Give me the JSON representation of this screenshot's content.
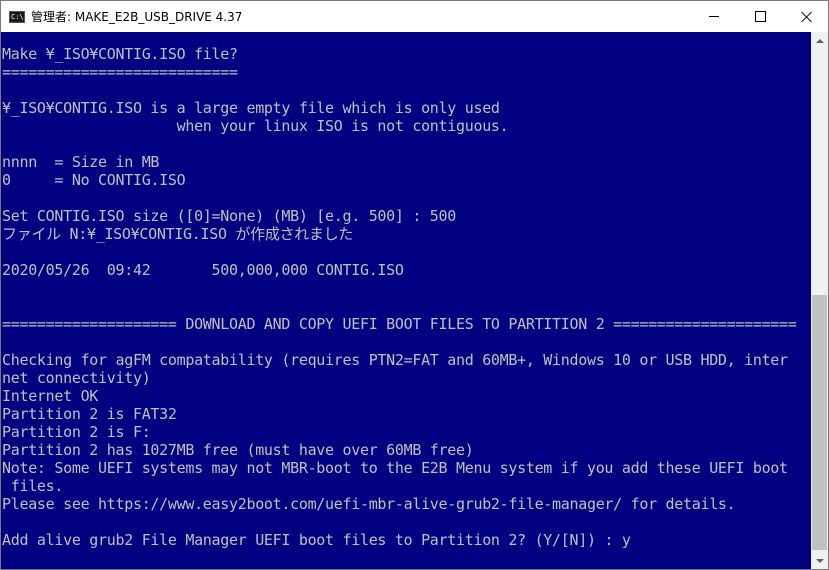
{
  "window": {
    "title": "管理者:  MAKE_E2B_USB_DRIVE 4.37",
    "icon": "console-icon",
    "icon_glyph": "C:\\",
    "minimize_glyph": "",
    "maximize_glyph": "",
    "close_glyph": ""
  },
  "colors": {
    "console_background": "#000080",
    "console_text": "#c0c0c0",
    "titlebar_background": "#ffffff"
  },
  "console": {
    "lines": [
      "Make ¥_ISO¥CONTIG.ISO file?",
      "===========================",
      "",
      "¥_ISO¥CONTIG.ISO is a large empty file which is only used",
      "                    when your linux ISO is not contiguous.",
      "",
      "nnnn  = Size in MB",
      "0     = No CONTIG.ISO",
      "",
      "Set CONTIG.ISO size ([0]=None) (MB) [e.g. 500] : 500",
      "ファイル N:¥_ISO¥CONTIG.ISO が作成されました",
      "",
      "2020/05/26  09:42       500,000,000 CONTIG.ISO",
      "",
      "",
      "==================== DOWNLOAD AND COPY UEFI BOOT FILES TO PARTITION 2 =====================",
      "",
      "Checking for agFM compatability (requires PTN2=FAT and 60MB+, Windows 10 or USB HDD, inter",
      "net connectivity)",
      "Internet OK",
      "Partition 2 is FAT32",
      "Partition 2 is F:",
      "Partition 2 has 1027MB free (must have over 60MB free)",
      "Note: Some UEFI systems may not MBR-boot to the E2B Menu system if you add these UEFI boot",
      " files.",
      "Please see https://www.easy2boot.com/uefi-mbr-alive-grub2-file-manager/ for details.",
      "",
      "Add alive grub2 File Manager UEFI boot files to Partition 2? (Y/[N]) : y"
    ]
  }
}
